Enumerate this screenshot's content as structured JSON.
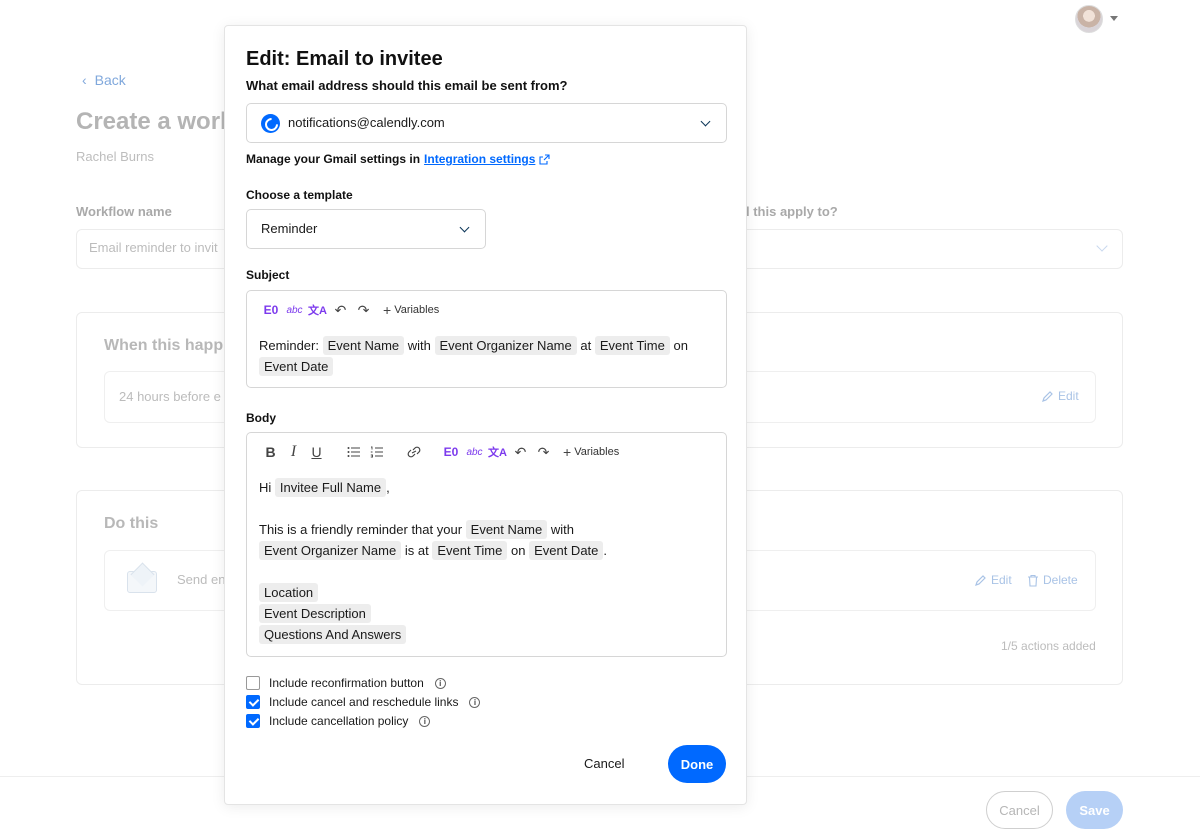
{
  "header": {
    "avatar_icon": "user-avatar",
    "caret_icon": "caret-down-icon"
  },
  "page": {
    "back_label": "Back",
    "title": "Create a work",
    "owner": "Rachel Burns",
    "workflow_name_label": "Workflow name",
    "workflow_name_value": "Email reminder to invit",
    "apply_label": "l this apply to?",
    "when_title": "When this happ",
    "when_value": "24 hours before e",
    "when_edit": "Edit",
    "do_title": "Do this",
    "do_value": "Send en",
    "do_edit": "Edit",
    "do_delete": "Delete",
    "actions_count": "1/5 actions added",
    "cancel_label": "Cancel",
    "save_label": "Save"
  },
  "modal": {
    "title": "Edit: Email to invitee",
    "from_question": "What email address should this email be sent from?",
    "from_value": "notifications@calendly.com",
    "gmail_note_prefix": "Manage your Gmail settings in",
    "gmail_link": "Integration settings",
    "template_label": "Choose a template",
    "template_value": "Reminder",
    "subject_label": "Subject",
    "body_label": "Body",
    "variables_label": "Variables",
    "subject": {
      "t1": "Reminder:",
      "c1": "Event Name",
      "t2": "with",
      "c2": "Event Organizer Name",
      "t3": "at",
      "c3": "Event Time",
      "t4": "on",
      "c4": "Event Date"
    },
    "body": {
      "hi": "Hi",
      "c_invitee": "Invitee Full Name",
      "comma": ",",
      "l2_text": "This is a friendly reminder that your",
      "l2_chip": "Event Name",
      "l2_with": "with",
      "l3_chip1": "Event Organizer Name",
      "l3_isat": "is at",
      "l3_chip2": "Event Time",
      "l3_on": "on",
      "l3_chip3": "Event Date",
      "l3_dot": ".",
      "c_location": "Location",
      "c_description": "Event Description",
      "c_qa": "Questions And Answers"
    },
    "toolbar": {
      "bold": "B",
      "italic": "I",
      "underline": "U",
      "ai": "E0",
      "spell": "abc",
      "translate": "文A"
    },
    "checks": [
      {
        "label": "Include reconfirmation button",
        "checked": false
      },
      {
        "label": "Include cancel and reschedule links",
        "checked": true
      },
      {
        "label": "Include cancellation policy",
        "checked": true
      }
    ],
    "cancel_label": "Cancel",
    "done_label": "Done"
  }
}
